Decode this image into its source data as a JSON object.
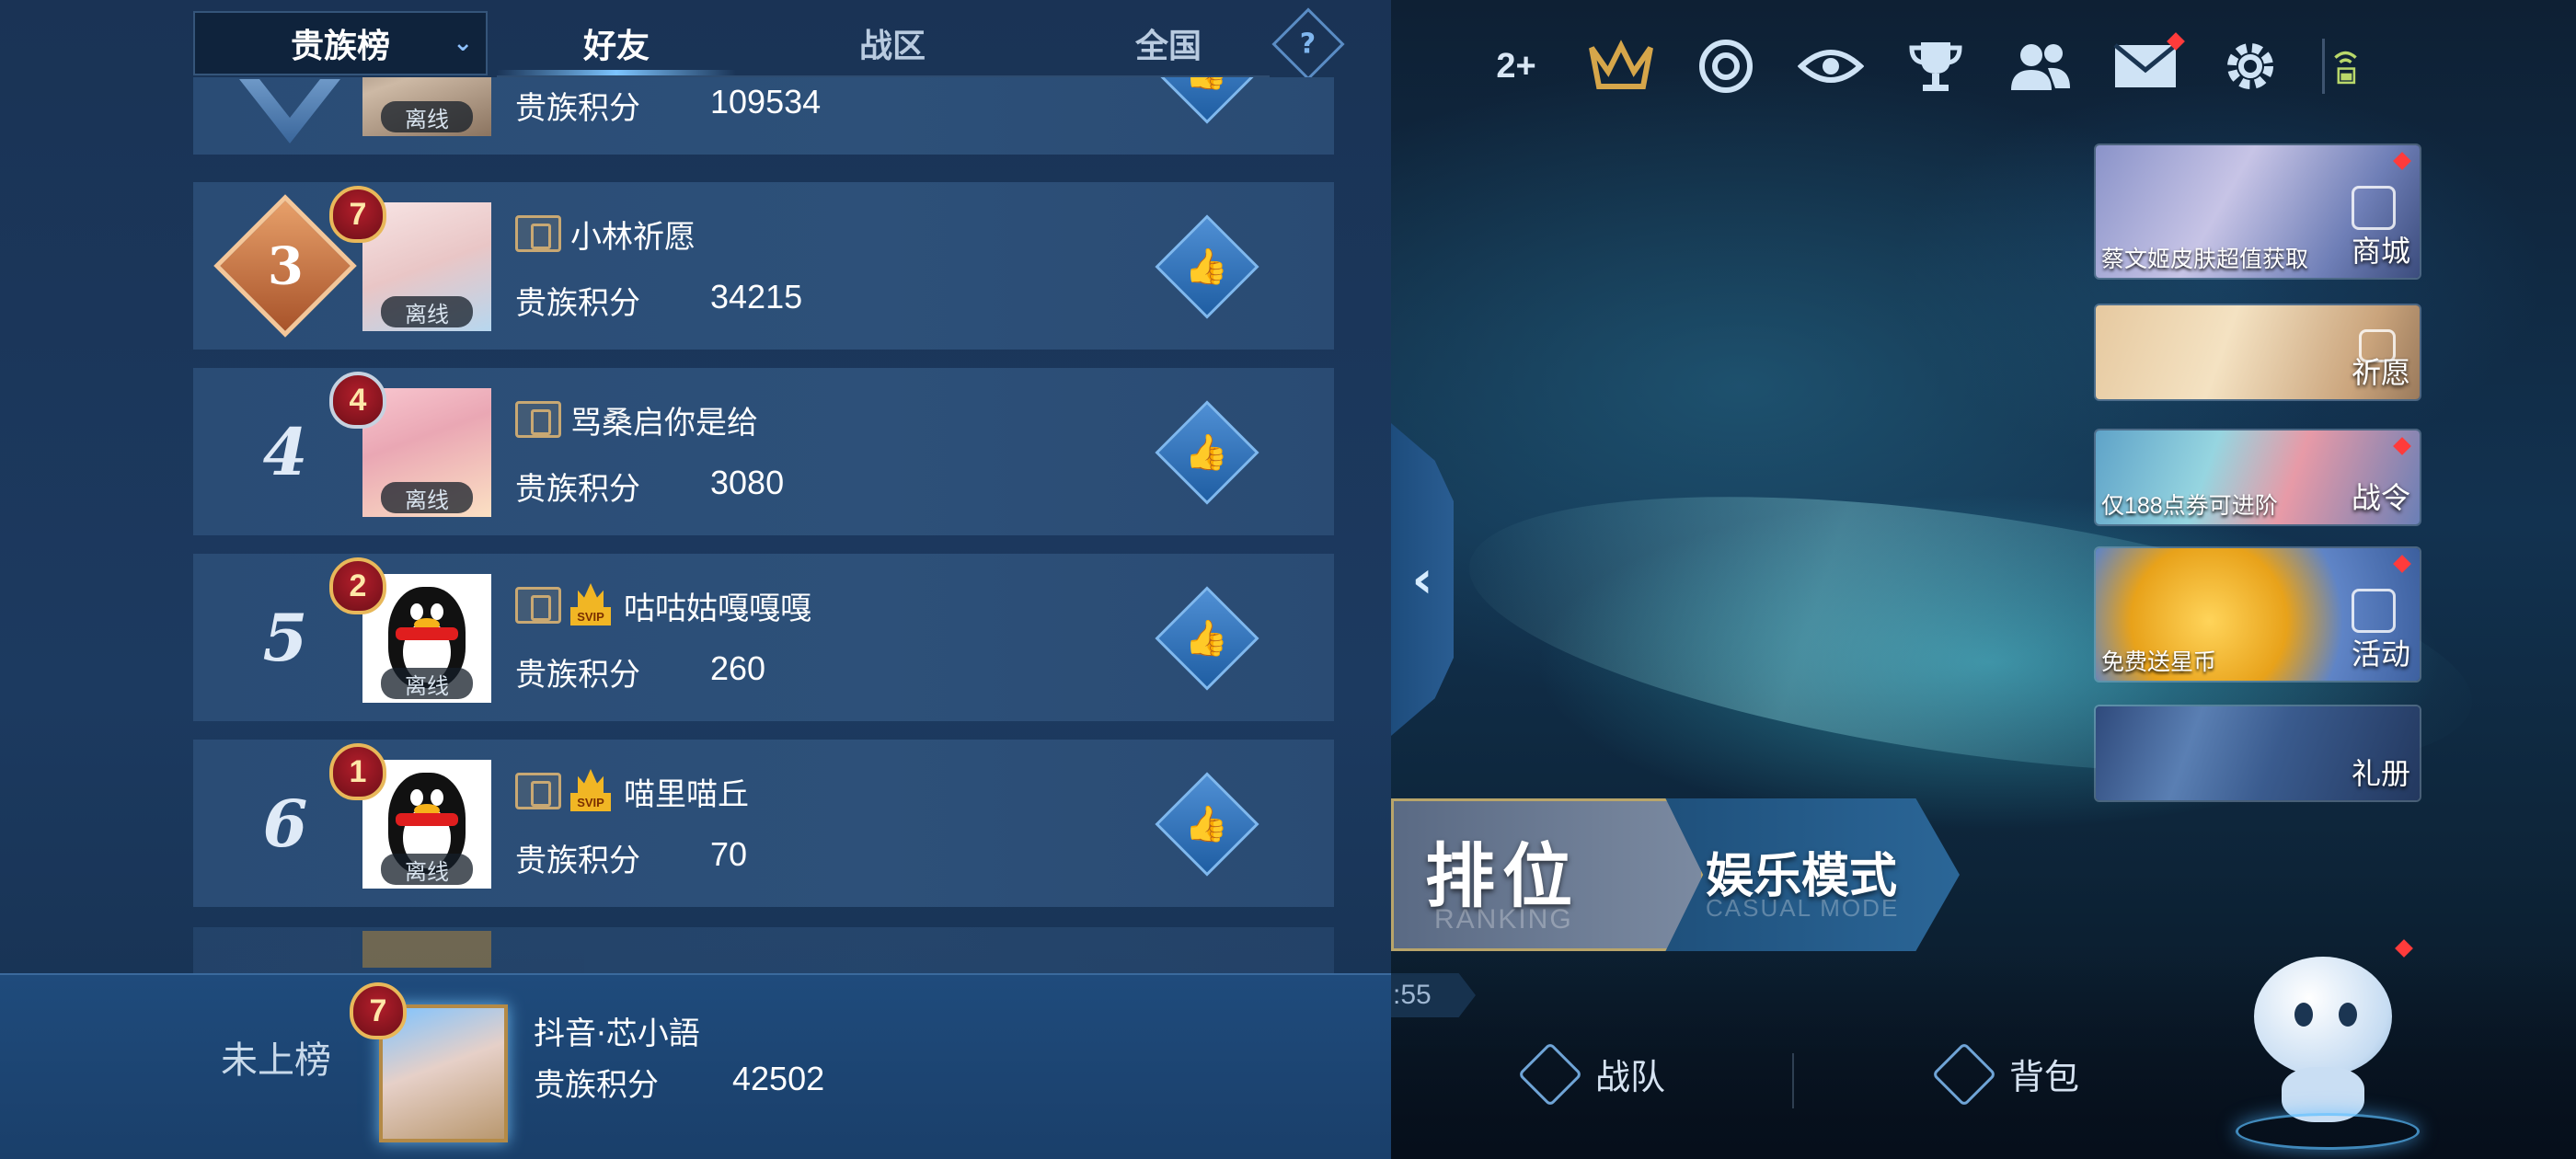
{
  "leaderboard": {
    "board_select": "贵族榜",
    "tabs": [
      {
        "label": "好友",
        "active": true
      },
      {
        "label": "战区",
        "active": false
      },
      {
        "label": "全国",
        "active": false
      }
    ],
    "help_label": "?",
    "offline_label": "离线",
    "score_label": "贵族积分",
    "entries": [
      {
        "rank": "",
        "name": "",
        "level": "",
        "score": "109534"
      },
      {
        "rank": "3",
        "name": "小林祈愿",
        "level": "7",
        "score": "34215",
        "svip": false
      },
      {
        "rank": "4",
        "name": "骂桑启你是给",
        "level": "4",
        "score": "3080",
        "svip": false
      },
      {
        "rank": "5",
        "name": "咕咕姑嘎嘎嘎",
        "level": "2",
        "score": "260",
        "svip": true
      },
      {
        "rank": "6",
        "name": "喵里喵丘",
        "level": "1",
        "score": "70",
        "svip": true
      }
    ],
    "svip_tag": "SVIP",
    "me": {
      "status": "未上榜",
      "name": "抖音·芯小語",
      "level": "7",
      "score": "42502"
    }
  },
  "topbar": {
    "friends_count": "2+",
    "icons": [
      "crown-wings-icon",
      "target-icon",
      "eye-icon",
      "trophy-icon",
      "friends-icon",
      "mail-icon",
      "gear-icon"
    ]
  },
  "promos": [
    {
      "caption": "蔡文姬皮肤超值获取",
      "label": "商城"
    },
    {
      "caption": "",
      "label": "祈愿"
    },
    {
      "caption": "仅188点券可进阶",
      "label": "战令"
    },
    {
      "caption": "免费送星币",
      "label": "活动"
    },
    {
      "caption": "",
      "label": "礼册"
    }
  ],
  "modes": {
    "rank": {
      "zh": "排位",
      "en": "RANKING"
    },
    "casual": {
      "zh": "娱乐模式",
      "en": "CASUAL MODE"
    }
  },
  "timer": ":55",
  "bottom_nav": {
    "team": "战队",
    "bag": "背包"
  }
}
